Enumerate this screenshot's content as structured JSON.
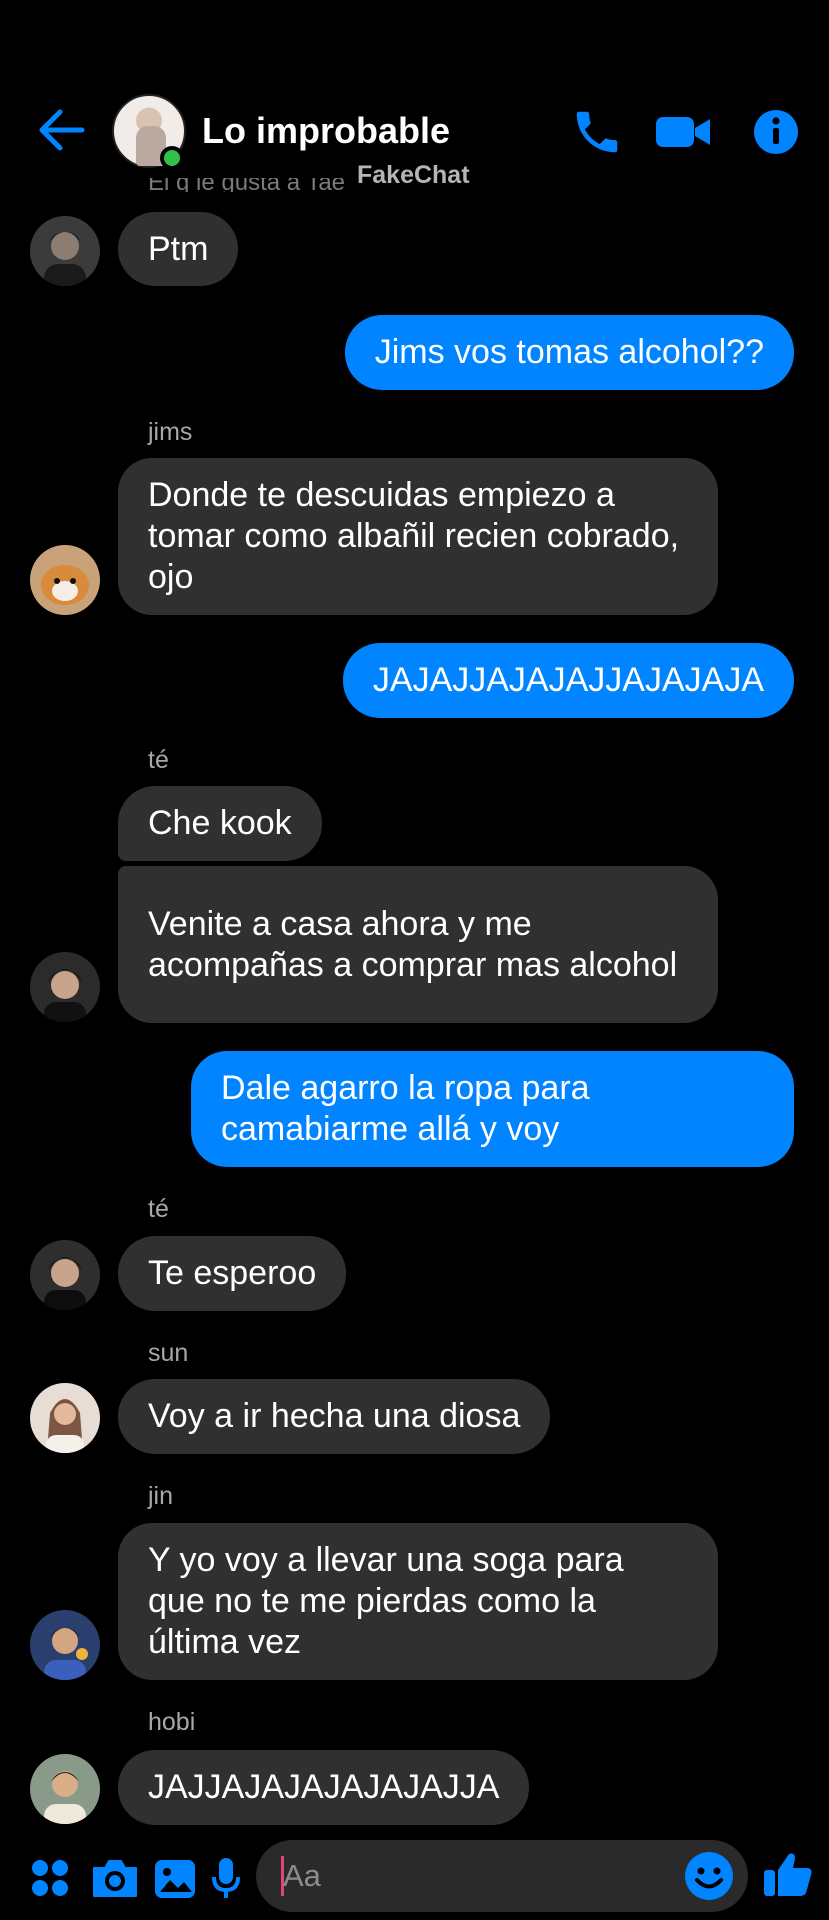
{
  "header": {
    "title": "Lo improbable",
    "watermark": "FakeChat",
    "cut_text": "El q le gusta a Tae",
    "icons": [
      "back-arrow-icon",
      "phone-icon",
      "video-camera-icon",
      "info-icon"
    ]
  },
  "colors": {
    "accent": "#0084ff",
    "incoming_bubble": "#303030",
    "online": "#31c14a",
    "background": "#000000"
  },
  "messages": [
    {
      "text": "Ptm"
    },
    {
      "text": "Jims vos tomas alcohol??"
    },
    {
      "sender": "jims",
      "text": "Donde te descuidas empiezo a tomar como albañil recien cobrado, ojo"
    },
    {
      "text": "JAJAJJAJAJAJJAJAJAJA"
    },
    {
      "sender": "té",
      "text": "Che kook"
    },
    {
      "text": "Venite a casa ahora y me acompañas a comprar mas alcohol"
    },
    {
      "text": "Dale agarro la ropa para camabiarme allá y voy"
    },
    {
      "sender": "té",
      "text": "Te esperoo"
    },
    {
      "sender": "sun",
      "text": "Voy a ir hecha una diosa"
    },
    {
      "sender": "jin",
      "text": "Y yo voy  a llevar una soga para que no te me pierdas como la última vez"
    },
    {
      "sender": "hobi",
      "text": "JAJJAJAJAJAJAJAJJA"
    }
  ],
  "composer": {
    "placeholder": "Aa",
    "icons": [
      "apps-grid-icon",
      "camera-icon",
      "gallery-icon",
      "microphone-icon",
      "emoji-icon",
      "thumbs-up-icon"
    ]
  }
}
